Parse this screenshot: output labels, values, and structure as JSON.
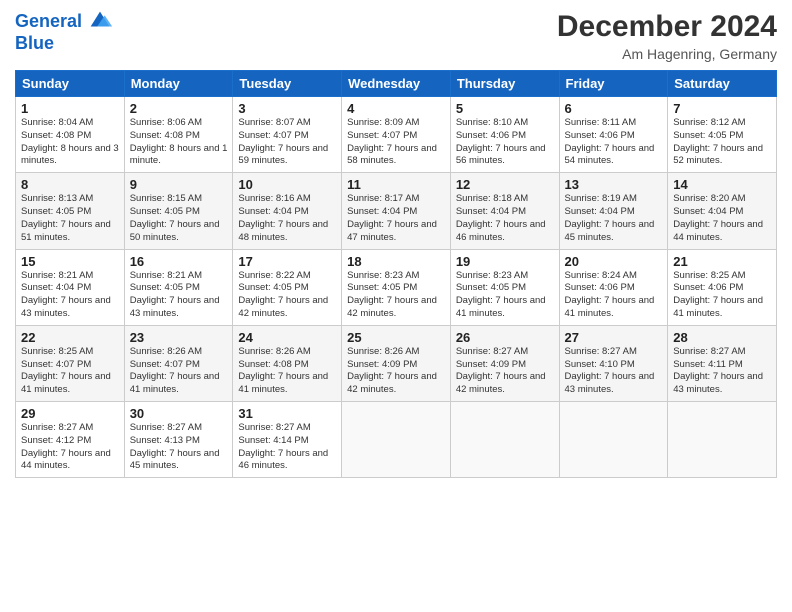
{
  "logo": {
    "line1": "General",
    "line2": "Blue"
  },
  "header": {
    "title": "December 2024",
    "location": "Am Hagenring, Germany"
  },
  "columns": [
    "Sunday",
    "Monday",
    "Tuesday",
    "Wednesday",
    "Thursday",
    "Friday",
    "Saturday"
  ],
  "weeks": [
    [
      {
        "day": "1",
        "sunrise": "Sunrise: 8:04 AM",
        "sunset": "Sunset: 4:08 PM",
        "daylight": "Daylight: 8 hours and 3 minutes."
      },
      {
        "day": "2",
        "sunrise": "Sunrise: 8:06 AM",
        "sunset": "Sunset: 4:08 PM",
        "daylight": "Daylight: 8 hours and 1 minute."
      },
      {
        "day": "3",
        "sunrise": "Sunrise: 8:07 AM",
        "sunset": "Sunset: 4:07 PM",
        "daylight": "Daylight: 7 hours and 59 minutes."
      },
      {
        "day": "4",
        "sunrise": "Sunrise: 8:09 AM",
        "sunset": "Sunset: 4:07 PM",
        "daylight": "Daylight: 7 hours and 58 minutes."
      },
      {
        "day": "5",
        "sunrise": "Sunrise: 8:10 AM",
        "sunset": "Sunset: 4:06 PM",
        "daylight": "Daylight: 7 hours and 56 minutes."
      },
      {
        "day": "6",
        "sunrise": "Sunrise: 8:11 AM",
        "sunset": "Sunset: 4:06 PM",
        "daylight": "Daylight: 7 hours and 54 minutes."
      },
      {
        "day": "7",
        "sunrise": "Sunrise: 8:12 AM",
        "sunset": "Sunset: 4:05 PM",
        "daylight": "Daylight: 7 hours and 52 minutes."
      }
    ],
    [
      {
        "day": "8",
        "sunrise": "Sunrise: 8:13 AM",
        "sunset": "Sunset: 4:05 PM",
        "daylight": "Daylight: 7 hours and 51 minutes."
      },
      {
        "day": "9",
        "sunrise": "Sunrise: 8:15 AM",
        "sunset": "Sunset: 4:05 PM",
        "daylight": "Daylight: 7 hours and 50 minutes."
      },
      {
        "day": "10",
        "sunrise": "Sunrise: 8:16 AM",
        "sunset": "Sunset: 4:04 PM",
        "daylight": "Daylight: 7 hours and 48 minutes."
      },
      {
        "day": "11",
        "sunrise": "Sunrise: 8:17 AM",
        "sunset": "Sunset: 4:04 PM",
        "daylight": "Daylight: 7 hours and 47 minutes."
      },
      {
        "day": "12",
        "sunrise": "Sunrise: 8:18 AM",
        "sunset": "Sunset: 4:04 PM",
        "daylight": "Daylight: 7 hours and 46 minutes."
      },
      {
        "day": "13",
        "sunrise": "Sunrise: 8:19 AM",
        "sunset": "Sunset: 4:04 PM",
        "daylight": "Daylight: 7 hours and 45 minutes."
      },
      {
        "day": "14",
        "sunrise": "Sunrise: 8:20 AM",
        "sunset": "Sunset: 4:04 PM",
        "daylight": "Daylight: 7 hours and 44 minutes."
      }
    ],
    [
      {
        "day": "15",
        "sunrise": "Sunrise: 8:21 AM",
        "sunset": "Sunset: 4:04 PM",
        "daylight": "Daylight: 7 hours and 43 minutes."
      },
      {
        "day": "16",
        "sunrise": "Sunrise: 8:21 AM",
        "sunset": "Sunset: 4:05 PM",
        "daylight": "Daylight: 7 hours and 43 minutes."
      },
      {
        "day": "17",
        "sunrise": "Sunrise: 8:22 AM",
        "sunset": "Sunset: 4:05 PM",
        "daylight": "Daylight: 7 hours and 42 minutes."
      },
      {
        "day": "18",
        "sunrise": "Sunrise: 8:23 AM",
        "sunset": "Sunset: 4:05 PM",
        "daylight": "Daylight: 7 hours and 42 minutes."
      },
      {
        "day": "19",
        "sunrise": "Sunrise: 8:23 AM",
        "sunset": "Sunset: 4:05 PM",
        "daylight": "Daylight: 7 hours and 41 minutes."
      },
      {
        "day": "20",
        "sunrise": "Sunrise: 8:24 AM",
        "sunset": "Sunset: 4:06 PM",
        "daylight": "Daylight: 7 hours and 41 minutes."
      },
      {
        "day": "21",
        "sunrise": "Sunrise: 8:25 AM",
        "sunset": "Sunset: 4:06 PM",
        "daylight": "Daylight: 7 hours and 41 minutes."
      }
    ],
    [
      {
        "day": "22",
        "sunrise": "Sunrise: 8:25 AM",
        "sunset": "Sunset: 4:07 PM",
        "daylight": "Daylight: 7 hours and 41 minutes."
      },
      {
        "day": "23",
        "sunrise": "Sunrise: 8:26 AM",
        "sunset": "Sunset: 4:07 PM",
        "daylight": "Daylight: 7 hours and 41 minutes."
      },
      {
        "day": "24",
        "sunrise": "Sunrise: 8:26 AM",
        "sunset": "Sunset: 4:08 PM",
        "daylight": "Daylight: 7 hours and 41 minutes."
      },
      {
        "day": "25",
        "sunrise": "Sunrise: 8:26 AM",
        "sunset": "Sunset: 4:09 PM",
        "daylight": "Daylight: 7 hours and 42 minutes."
      },
      {
        "day": "26",
        "sunrise": "Sunrise: 8:27 AM",
        "sunset": "Sunset: 4:09 PM",
        "daylight": "Daylight: 7 hours and 42 minutes."
      },
      {
        "day": "27",
        "sunrise": "Sunrise: 8:27 AM",
        "sunset": "Sunset: 4:10 PM",
        "daylight": "Daylight: 7 hours and 43 minutes."
      },
      {
        "day": "28",
        "sunrise": "Sunrise: 8:27 AM",
        "sunset": "Sunset: 4:11 PM",
        "daylight": "Daylight: 7 hours and 43 minutes."
      }
    ],
    [
      {
        "day": "29",
        "sunrise": "Sunrise: 8:27 AM",
        "sunset": "Sunset: 4:12 PM",
        "daylight": "Daylight: 7 hours and 44 minutes."
      },
      {
        "day": "30",
        "sunrise": "Sunrise: 8:27 AM",
        "sunset": "Sunset: 4:13 PM",
        "daylight": "Daylight: 7 hours and 45 minutes."
      },
      {
        "day": "31",
        "sunrise": "Sunrise: 8:27 AM",
        "sunset": "Sunset: 4:14 PM",
        "daylight": "Daylight: 7 hours and 46 minutes."
      },
      null,
      null,
      null,
      null
    ]
  ]
}
